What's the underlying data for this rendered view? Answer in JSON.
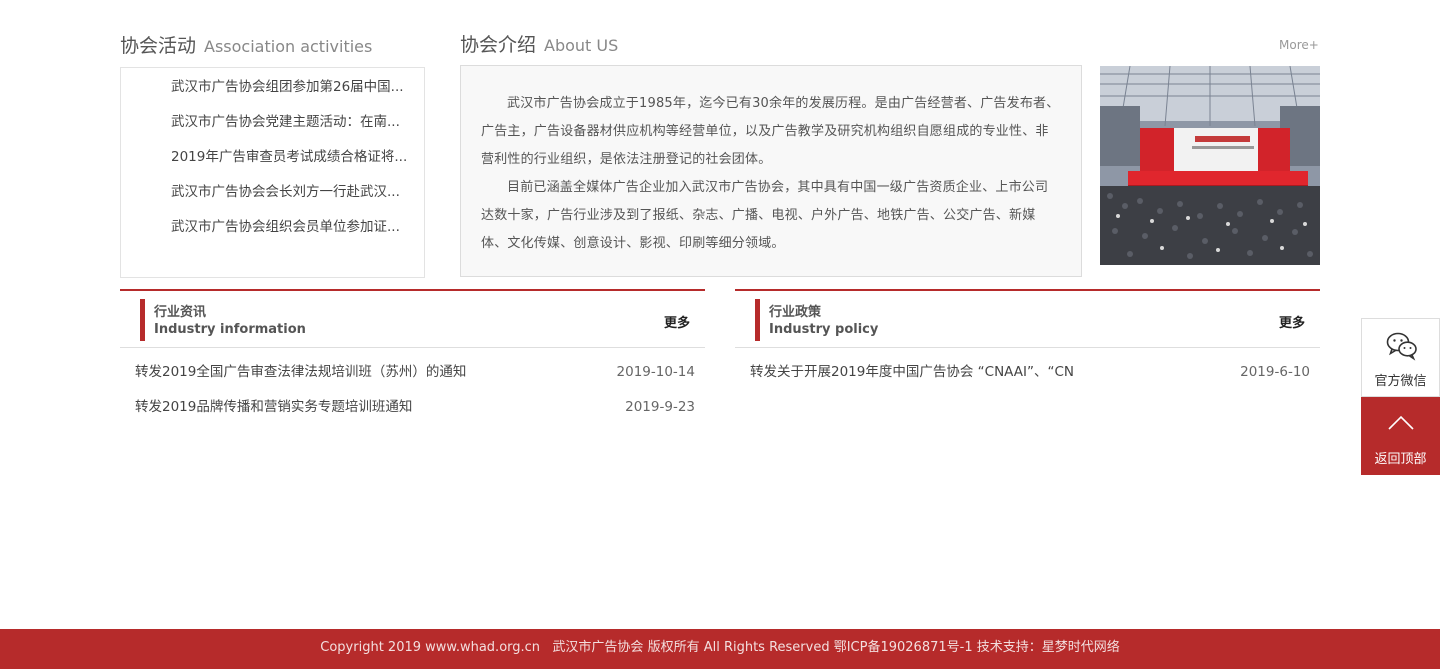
{
  "activities": {
    "title_cn": "协会活动",
    "title_en": "Association activities",
    "items": [
      "武汉市广告协会组团参加第26届中国...",
      "武汉市广告协会党建主题活动：在南...",
      "2019年广告审查员考试成绩合格证将...",
      "武汉市广告协会会长刘方一行赴武汉...",
      "武汉市广告协会组织会员单位参加证..."
    ]
  },
  "about": {
    "title_cn": "协会介绍",
    "title_en": "About US",
    "more_label": "More+",
    "paragraphs": [
      "武汉市广告协会成立于1985年，迄今已有30余年的发展历程。是由广告经营者、广告发布者、广告主，广告设备器材供应机构等经营单位，以及广告教学及研究机构组织自愿组成的专业性、非营利性的行业组织，是依法注册登记的社会团体。",
      "目前已涵盖全媒体广告企业加入武汉市广告协会，其中具有中国一级广告资质企业、上市公司达数十家，广告行业涉及到了报纸、杂志、广播、电视、户外广告、地铁广告、公交广告、新媒体、文化传媒、创意设计、影视、印刷等细分领域。"
    ]
  },
  "industry_info": {
    "title_cn": "行业资讯",
    "title_en": "Industry information",
    "more_label": "更多",
    "items": [
      {
        "title": "转发2019全国广告审查法律法规培训班（苏州）的通知",
        "date": "2019-10-14"
      },
      {
        "title": "转发2019品牌传播和营销实务专题培训班通知",
        "date": "2019-9-23"
      }
    ]
  },
  "industry_policy": {
    "title_cn": "行业政策",
    "title_en": "Industry policy",
    "more_label": "更多",
    "items": [
      {
        "title": "转发关于开展2019年度中国广告协会 “CNAAⅠ”、“CN",
        "date": "2019-6-10"
      }
    ]
  },
  "side": {
    "wechat_label": "官方微信",
    "wechat_icon": "wechat-icon",
    "top_label": "返回顶部",
    "top_icon": "chevron-up-icon"
  },
  "footer": {
    "text": "Copyright 2019 www.whad.org.cn   武汉市广告协会 版权所有 All Rights Reserved 鄂ICP备19026871号-1 技术支持：星梦时代网络"
  },
  "colors": {
    "accent": "#b62b2b",
    "text": "#444444",
    "muted": "#999999"
  }
}
